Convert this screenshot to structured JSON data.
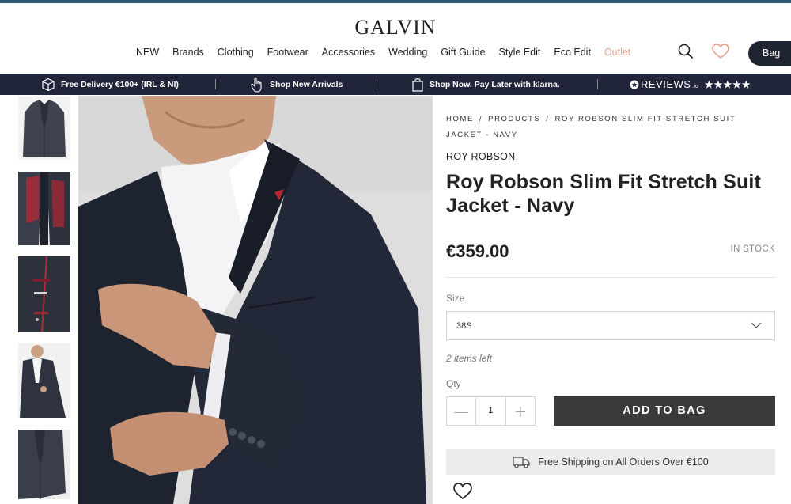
{
  "header": {
    "logo": "GALVIN",
    "nav": [
      "NEW",
      "Brands",
      "Clothing",
      "Footwear",
      "Accessories",
      "Wedding",
      "Gift Guide",
      "Style Edit",
      "Eco Edit",
      "Outlet"
    ],
    "bag_label": "Bag",
    "icons": [
      "search-icon",
      "heart-icon"
    ],
    "accent_outlet": "#e8a392"
  },
  "promo_bar": {
    "items": [
      {
        "icon": "box-icon",
        "text": "Free Delivery €100+ (IRL & NI)"
      },
      {
        "icon": "hand-pointer-icon",
        "text": "Shop New Arrivals"
      },
      {
        "icon": "shopping-bag-icon",
        "text": "Shop Now. Pay Later with klarna."
      }
    ],
    "reviews_label": "REVIEWS",
    "reviews_suffix": ".io",
    "stars": "★★★★★",
    "background": "#20253a"
  },
  "breadcrumb": [
    "HOME",
    "PRODUCTS",
    "ROY ROBSON SLIM FIT STRETCH SUIT JACKET - NAVY"
  ],
  "product": {
    "brand": "ROY ROBSON",
    "title": "Roy Robson Slim Fit Stretch Suit Jacket - Navy",
    "price": "€359.00",
    "stock": "IN STOCK",
    "size_label": "Size",
    "size_selected": "38S",
    "items_left": "2 items left",
    "qty_label": "Qty",
    "qty_value": "1",
    "add_to_bag": "ADD TO BAG",
    "shipping_note": "Free Shipping on All Orders Over €100"
  },
  "colors": {
    "top_strip": "#2f5670",
    "button_dark": "#3a3a3a",
    "bag_button": "#1f2433"
  }
}
